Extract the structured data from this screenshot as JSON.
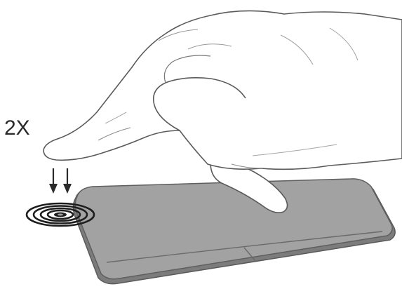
{
  "gesture": {
    "tap_count_label": "2X"
  },
  "icons": {
    "hand": "hand-icon",
    "tap_arrows": "down-arrow-icon",
    "tap_ripple": "tap-ripple-icon"
  },
  "colors": {
    "touchpad_fill": "#9a9a9a",
    "touchpad_edge": "#6e6e6e",
    "hand_fill": "#ffffff",
    "outline": "#5a5a5a",
    "text": "#2a2a2a"
  }
}
